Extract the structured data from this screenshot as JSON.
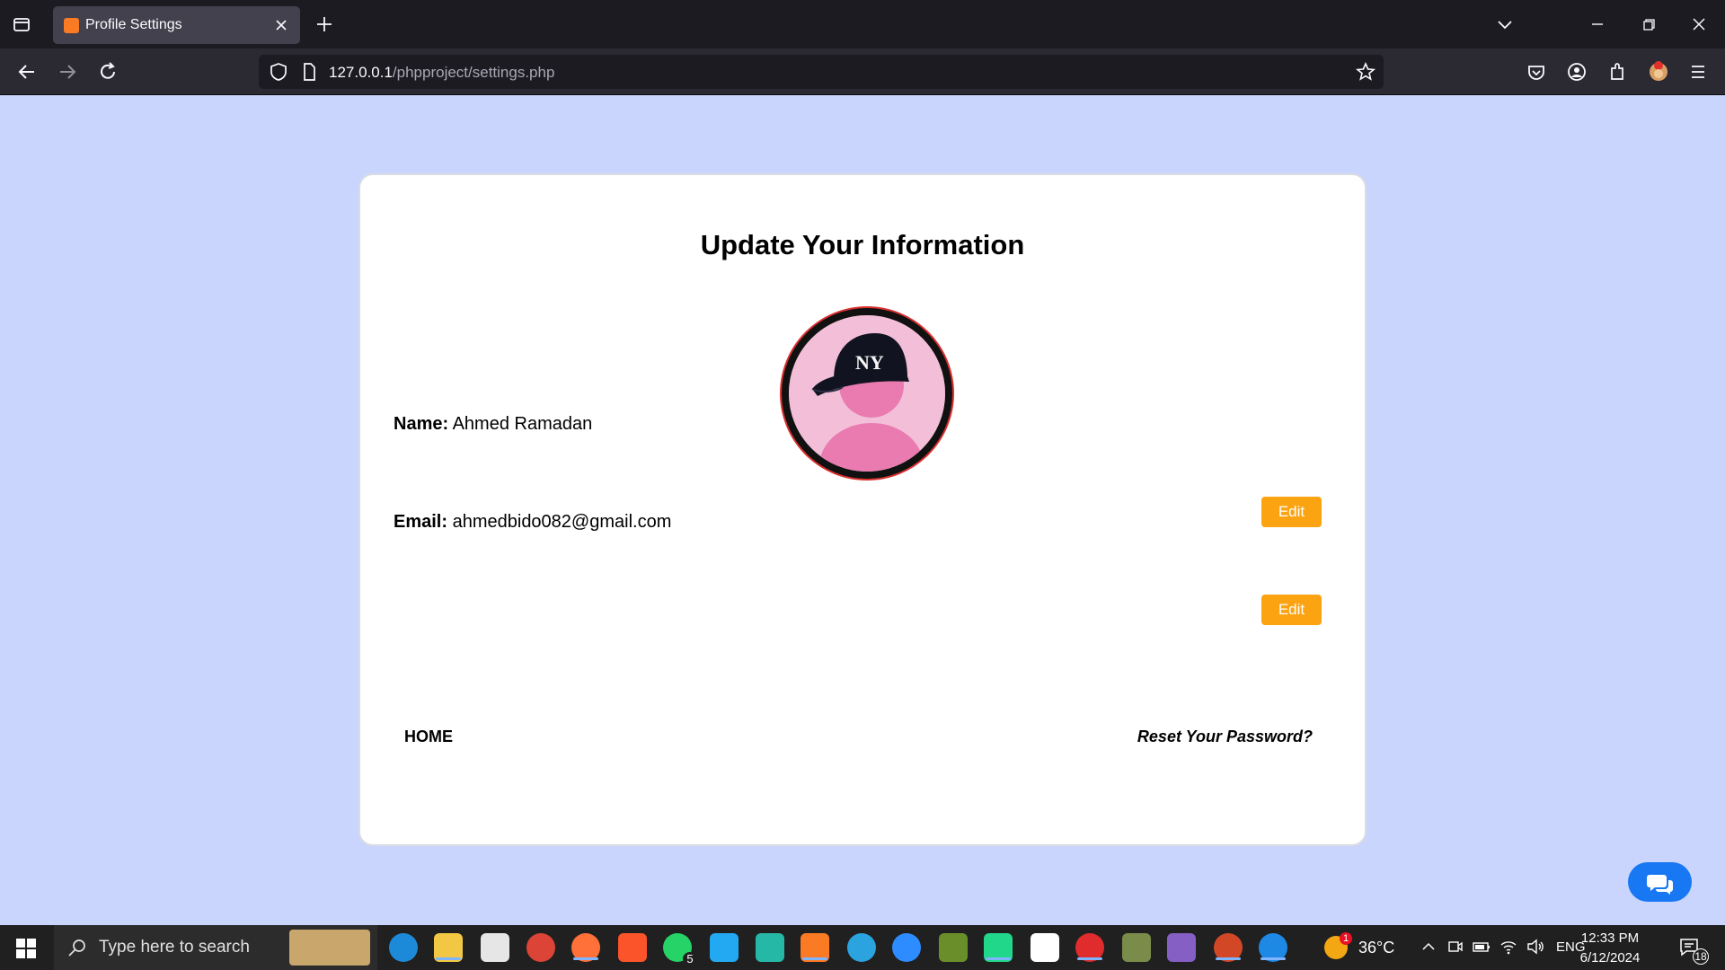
{
  "browser": {
    "tab_title": "Profile Settings",
    "url_host": "127.0.0.1",
    "url_path": "/phpproject/settings.php"
  },
  "page": {
    "title": "Update Your Information",
    "name_label": "Name:",
    "name_value": "Ahmed Ramadan",
    "email_label": "Email:",
    "email_value": "ahmedbido082@gmail.com",
    "edit_label": "Edit",
    "home_link": "HOME",
    "reset_link": "Reset Your Password?"
  },
  "taskbar": {
    "search_placeholder": "Type here to search",
    "weather": "36°C",
    "language": "ENG",
    "time": "12:33 PM",
    "date": "6/12/2024",
    "whatsapp_badge": "5",
    "notification_count": "18",
    "weather_badge": "1"
  },
  "colors": {
    "page_bg": "#c9d5fd",
    "edit_button": "#fca311",
    "chat_button": "#1877f2"
  }
}
